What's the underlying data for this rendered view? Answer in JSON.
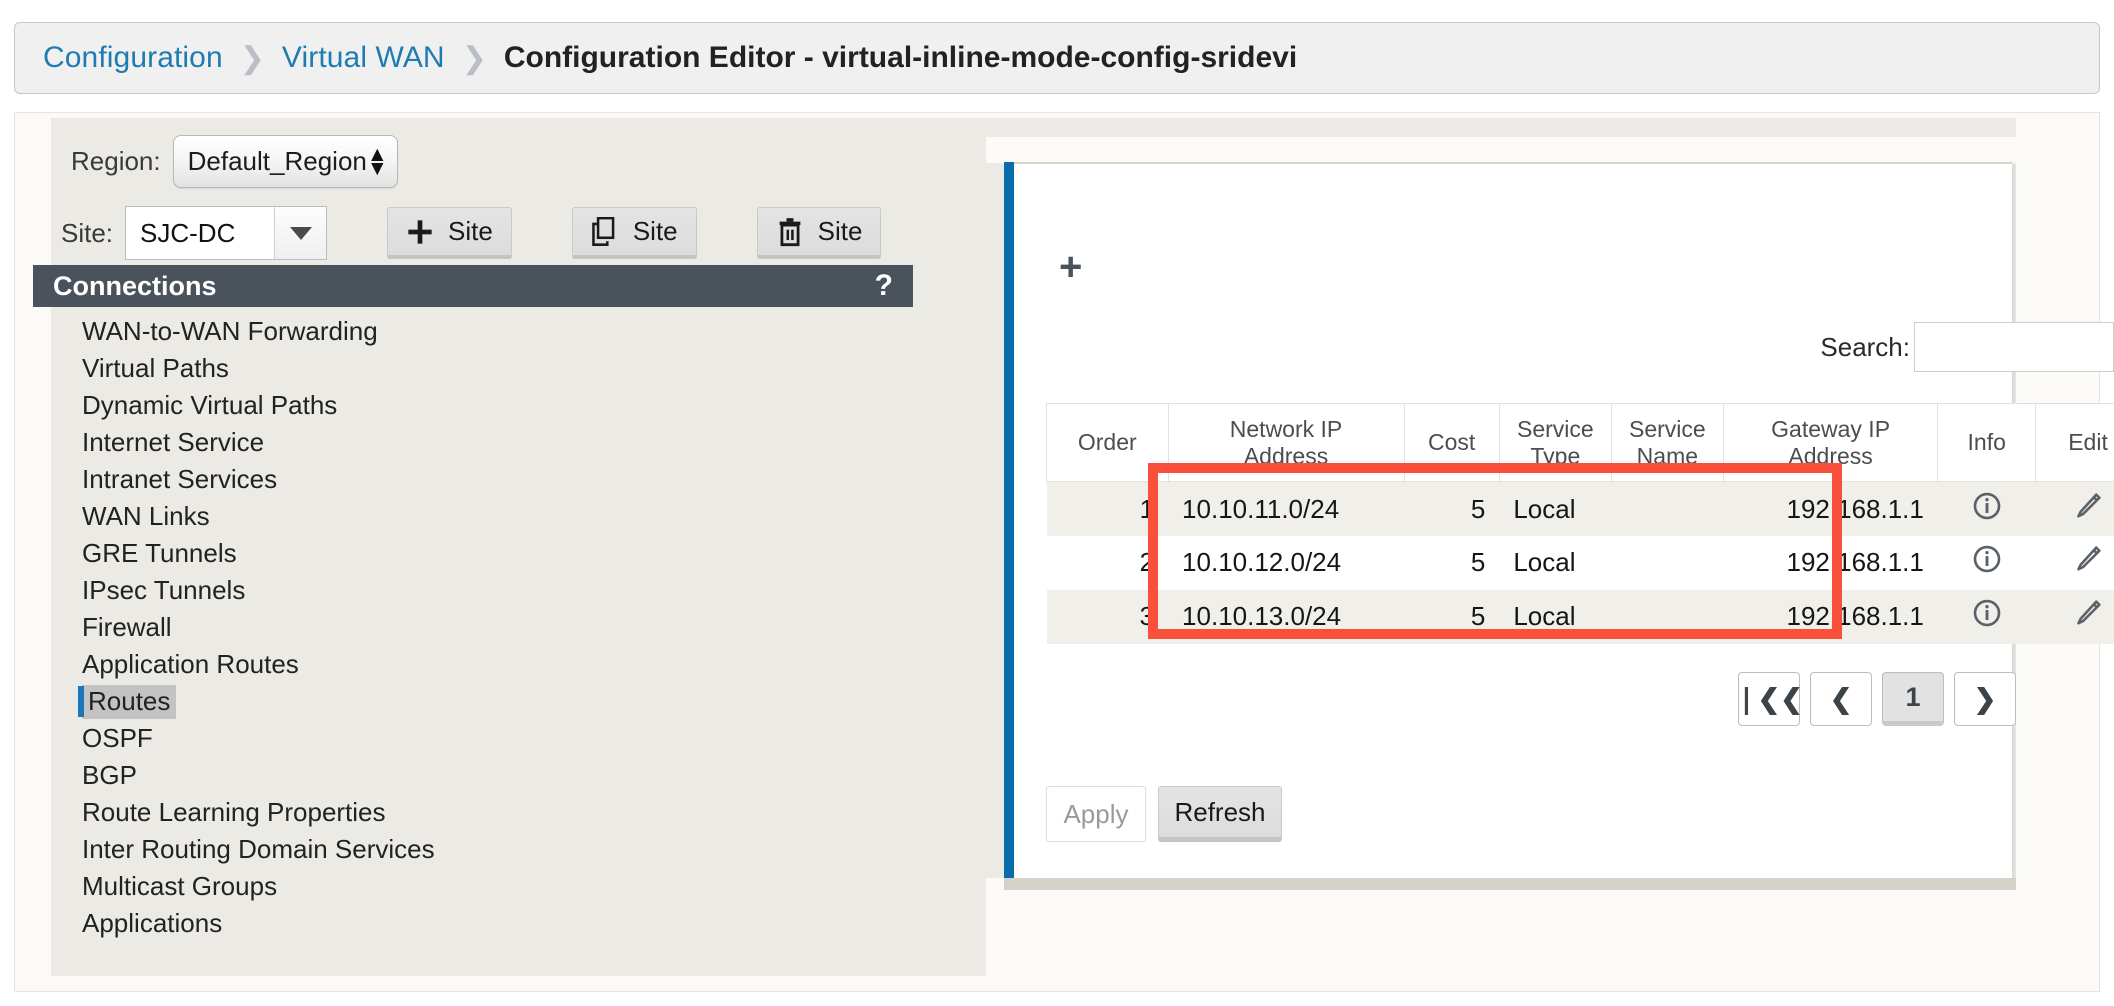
{
  "breadcrumb": {
    "items": [
      {
        "label": "Configuration",
        "current": false
      },
      {
        "label": "Virtual WAN",
        "current": false
      },
      {
        "label": "Configuration Editor - virtual-inline-mode-config-sridevi",
        "current": true
      }
    ],
    "separator": "❯"
  },
  "left_pane": {
    "region": {
      "label": "Region:",
      "value": "Default_Region"
    },
    "site": {
      "label": "Site:",
      "value": "SJC-DC"
    },
    "site_buttons": [
      {
        "icon": "plus-icon",
        "label": "Site",
        "glyph": "+"
      },
      {
        "icon": "copy-icon",
        "label": "Site",
        "glyph": ""
      },
      {
        "icon": "trash-icon",
        "label": "Site",
        "glyph": ""
      }
    ],
    "connections": {
      "title": "Connections",
      "help": "?",
      "items": [
        {
          "label": "WAN-to-WAN Forwarding",
          "selected": false
        },
        {
          "label": "Virtual Paths",
          "selected": false
        },
        {
          "label": "Dynamic Virtual Paths",
          "selected": false
        },
        {
          "label": "Internet Service",
          "selected": false
        },
        {
          "label": "Intranet Services",
          "selected": false
        },
        {
          "label": "WAN Links",
          "selected": false
        },
        {
          "label": "GRE Tunnels",
          "selected": false
        },
        {
          "label": "IPsec Tunnels",
          "selected": false
        },
        {
          "label": "Firewall",
          "selected": false
        },
        {
          "label": "Application Routes",
          "selected": false
        },
        {
          "label": "Routes",
          "selected": true
        },
        {
          "label": "OSPF",
          "selected": false
        },
        {
          "label": "BGP",
          "selected": false
        },
        {
          "label": "Route Learning Properties",
          "selected": false
        },
        {
          "label": "Inter Routing Domain Services",
          "selected": false
        },
        {
          "label": "Multicast Groups",
          "selected": false
        },
        {
          "label": "Applications",
          "selected": false
        }
      ]
    }
  },
  "right_pane": {
    "add_button": "+",
    "search": {
      "label": "Search:",
      "value": "",
      "placeholder": ""
    },
    "table": {
      "headers": [
        "Order",
        "Network IP\nAddress",
        "Cost",
        "Service\nType",
        "Service\nName",
        "Gateway IP\nAddress",
        "Info",
        "Edit"
      ],
      "headers_flat": [
        "Order",
        "Network IP Address",
        "Cost",
        "Service Type",
        "Service Name",
        "Gateway IP Address",
        "Info",
        "Edit"
      ],
      "rows": [
        {
          "order": "1",
          "network_ip_address": "10.10.11.0/24",
          "cost": "5",
          "service_type": "Local",
          "service_name": "",
          "gateway_ip_address": "192.168.1.1",
          "info_icon": "info-circle-icon",
          "edit_icon": "pencil-icon"
        },
        {
          "order": "2",
          "network_ip_address": "10.10.12.0/24",
          "cost": "5",
          "service_type": "Local",
          "service_name": "",
          "gateway_ip_address": "192.168.1.1",
          "info_icon": "info-circle-icon",
          "edit_icon": "pencil-icon"
        },
        {
          "order": "3",
          "network_ip_address": "10.10.13.0/24",
          "cost": "5",
          "service_type": "Local",
          "service_name": "",
          "gateway_ip_address": "192.168.1.1",
          "info_icon": "info-circle-icon",
          "edit_icon": "pencil-icon"
        }
      ]
    },
    "pagination": {
      "first": "❘❮❮",
      "prev": "❮",
      "current_page": "1",
      "next": "❯"
    },
    "actions": {
      "apply": "Apply",
      "apply_disabled": true,
      "refresh": "Refresh"
    }
  },
  "annotation": {
    "highlight_color": "#f9503c",
    "shape": "rectangle"
  },
  "colors": {
    "accent_blue": "#0b6cad",
    "link_blue": "#1f7cb0",
    "header_dark": "#4a525c",
    "panel_bg": "#eceae5",
    "highlight_red": "#f9503c",
    "selected_item_bg": "#c3c3c3",
    "selected_item_bar": "#1b75bb"
  }
}
